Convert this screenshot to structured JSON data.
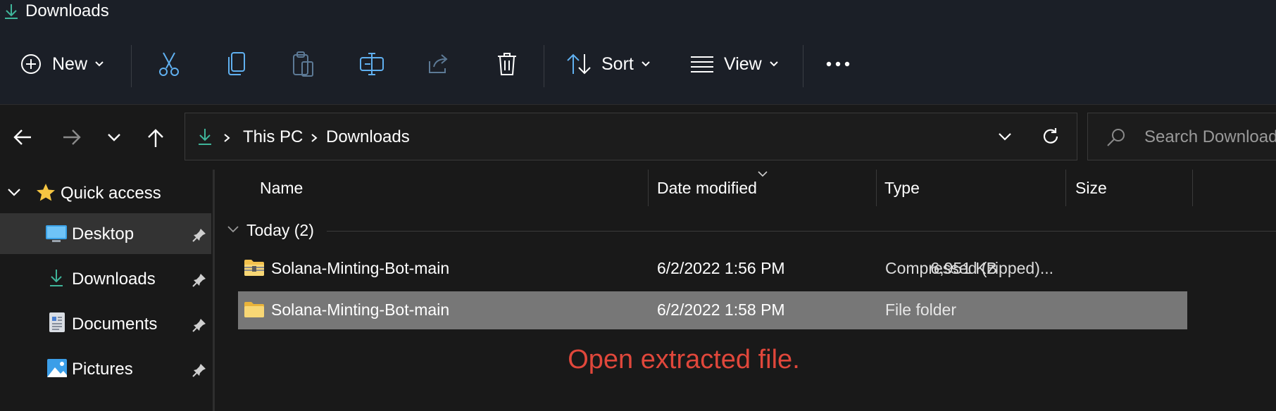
{
  "window": {
    "title": "Downloads"
  },
  "toolbar": {
    "new_label": "New",
    "sort_label": "Sort",
    "view_label": "View",
    "icons": [
      "cut-icon",
      "copy-icon",
      "paste-icon",
      "rename-icon",
      "share-icon",
      "delete-icon",
      "more-icon"
    ]
  },
  "address": {
    "crumbs": [
      "This PC",
      "Downloads"
    ]
  },
  "search": {
    "placeholder": "Search Downloads"
  },
  "sidebar": {
    "quick_access": "Quick access",
    "items": [
      {
        "label": "Desktop",
        "icon": "desktop-icon"
      },
      {
        "label": "Downloads",
        "icon": "download-icon"
      },
      {
        "label": "Documents",
        "icon": "document-icon"
      },
      {
        "label": "Pictures",
        "icon": "pictures-icon"
      }
    ]
  },
  "columns": {
    "name": "Name",
    "date": "Date modified",
    "type": "Type",
    "size": "Size"
  },
  "group": {
    "label": "Today (2)"
  },
  "files": [
    {
      "name": "Solana-Minting-Bot-main",
      "date": "6/2/2022 1:56 PM",
      "type": "Compressed (zipped)...",
      "size": "6,951 KB",
      "icon": "zip-folder-icon"
    },
    {
      "name": "Solana-Minting-Bot-main",
      "date": "6/2/2022 1:58 PM",
      "type": "File folder",
      "size": "",
      "icon": "folder-icon"
    }
  ],
  "annotation": "Open extracted file.",
  "colors": {
    "accent_green": "#3fb59a",
    "accent_blue": "#60b0f0",
    "annotation_red": "#e0473b",
    "selection": "#777777"
  }
}
